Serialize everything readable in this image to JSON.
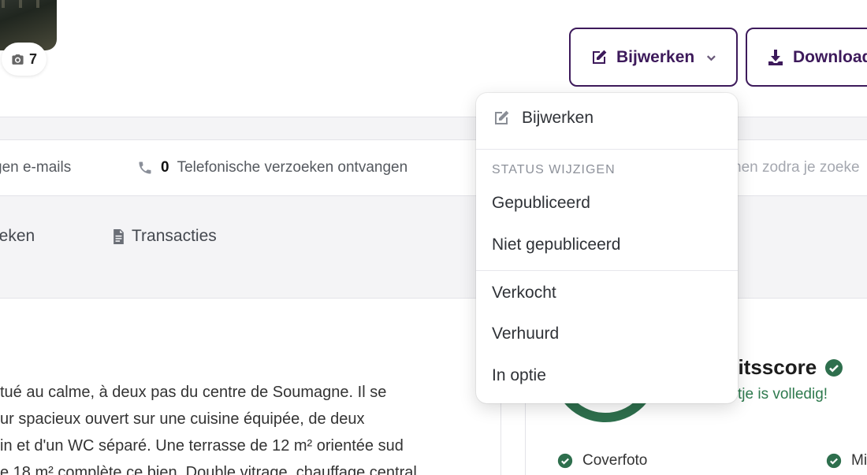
{
  "photo": {
    "count": "7",
    "icon": "camera-icon"
  },
  "toolbar": {
    "update_label": "Bijwerken",
    "download_label": "Download",
    "accent": "#3d1a5b"
  },
  "stats": {
    "emails_text": "gen e-mails",
    "phone_count": "0",
    "phone_text": "Telefonische verzoeken ontvangen",
    "tail_text": "nen zodra je zoeke"
  },
  "tabs": {
    "stats_label": "ieken",
    "transactions_label": "Transacties"
  },
  "description": {
    "lines": [
      "tué au calme, à deux pas du centre de Soumagne. Il se",
      "ur spacieux ouvert sur une cuisine équipée, de deux",
      "in et d'un WC séparé. Une terrasse de 12 m² orientée sud",
      "e 18 m² complète ce bien. Double vitrage, chauffage central"
    ]
  },
  "quality": {
    "title": "eitsscore",
    "subtitle": "tje is volledig!",
    "checks": [
      "Coverfoto",
      "Mi"
    ],
    "color": "#2e6f4d"
  },
  "dropdown": {
    "header_label": "Bijwerken",
    "section_label": "STATUS WIJZIGEN",
    "status_items": [
      "Gepubliceerd",
      "Niet gepubliceerd"
    ],
    "deal_items": [
      "Verkocht",
      "Verhuurd",
      "In optie"
    ]
  }
}
